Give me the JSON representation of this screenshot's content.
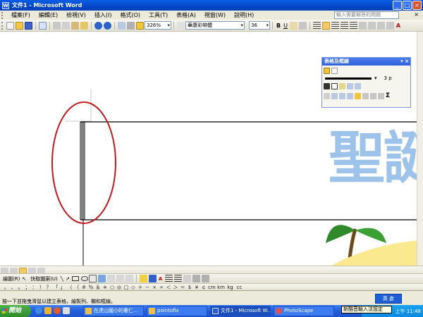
{
  "window": {
    "title": "文件1 - Microsoft Word",
    "app_icon": "W",
    "controls": {
      "minimize": "_",
      "maximize": "□",
      "close": "×"
    }
  },
  "menu": {
    "items": [
      "檔案(F)",
      "編輯(E)",
      "檢視(V)",
      "插入(I)",
      "格式(O)",
      "工具(T)",
      "表格(A)",
      "視窗(W)",
      "說明(H)"
    ],
    "help_placeholder": "輸入需要解答的問題",
    "doc_close": "×"
  },
  "standard_toolbar": {
    "zoom": "326%",
    "font_name": "華康彩帶體",
    "font_size": "36",
    "bold": "B",
    "underline": "U",
    "font_color_letter": "A"
  },
  "tables_borders": {
    "title": "表格及框線",
    "line_weight": "3 p",
    "autosum": "Σ"
  },
  "drawing_toolbar": {
    "draw_label": "繪圖(R)",
    "autoshapes_label": "快取圖案(U)"
  },
  "symbols": [
    "，",
    "、",
    "。",
    "；",
    "：",
    "！",
    "？",
    "「",
    "」",
    "（",
    "〔",
    "＃",
    "％",
    "＆",
    "＊",
    "○",
    "◎",
    "□",
    "◇",
    "＋",
    "－",
    "×",
    "÷",
    "＜",
    "＞",
    "＝",
    "$",
    "¥",
    "¢",
    "cm",
    "km",
    "kg",
    "cc"
  ],
  "status": {
    "hint": "按一下並拖曳滑鼠以建立表格，繪製列、欄和框線。",
    "ime": "英 倉",
    "tooltip": "新酷音輸入法設定"
  },
  "taskbar": {
    "start_label": "開始",
    "tasks": [
      "在虎山國小的著仁...",
      "pointofix",
      "文件1 - Microsoft W...",
      "PhotoScape"
    ],
    "clock": "上午 11:48"
  },
  "document": {
    "display_text": "聖誕"
  },
  "colors": {
    "title_bar": "#0447c6",
    "annotation_ellipse": "#c0191f",
    "art_text": "#9ec3ea"
  }
}
